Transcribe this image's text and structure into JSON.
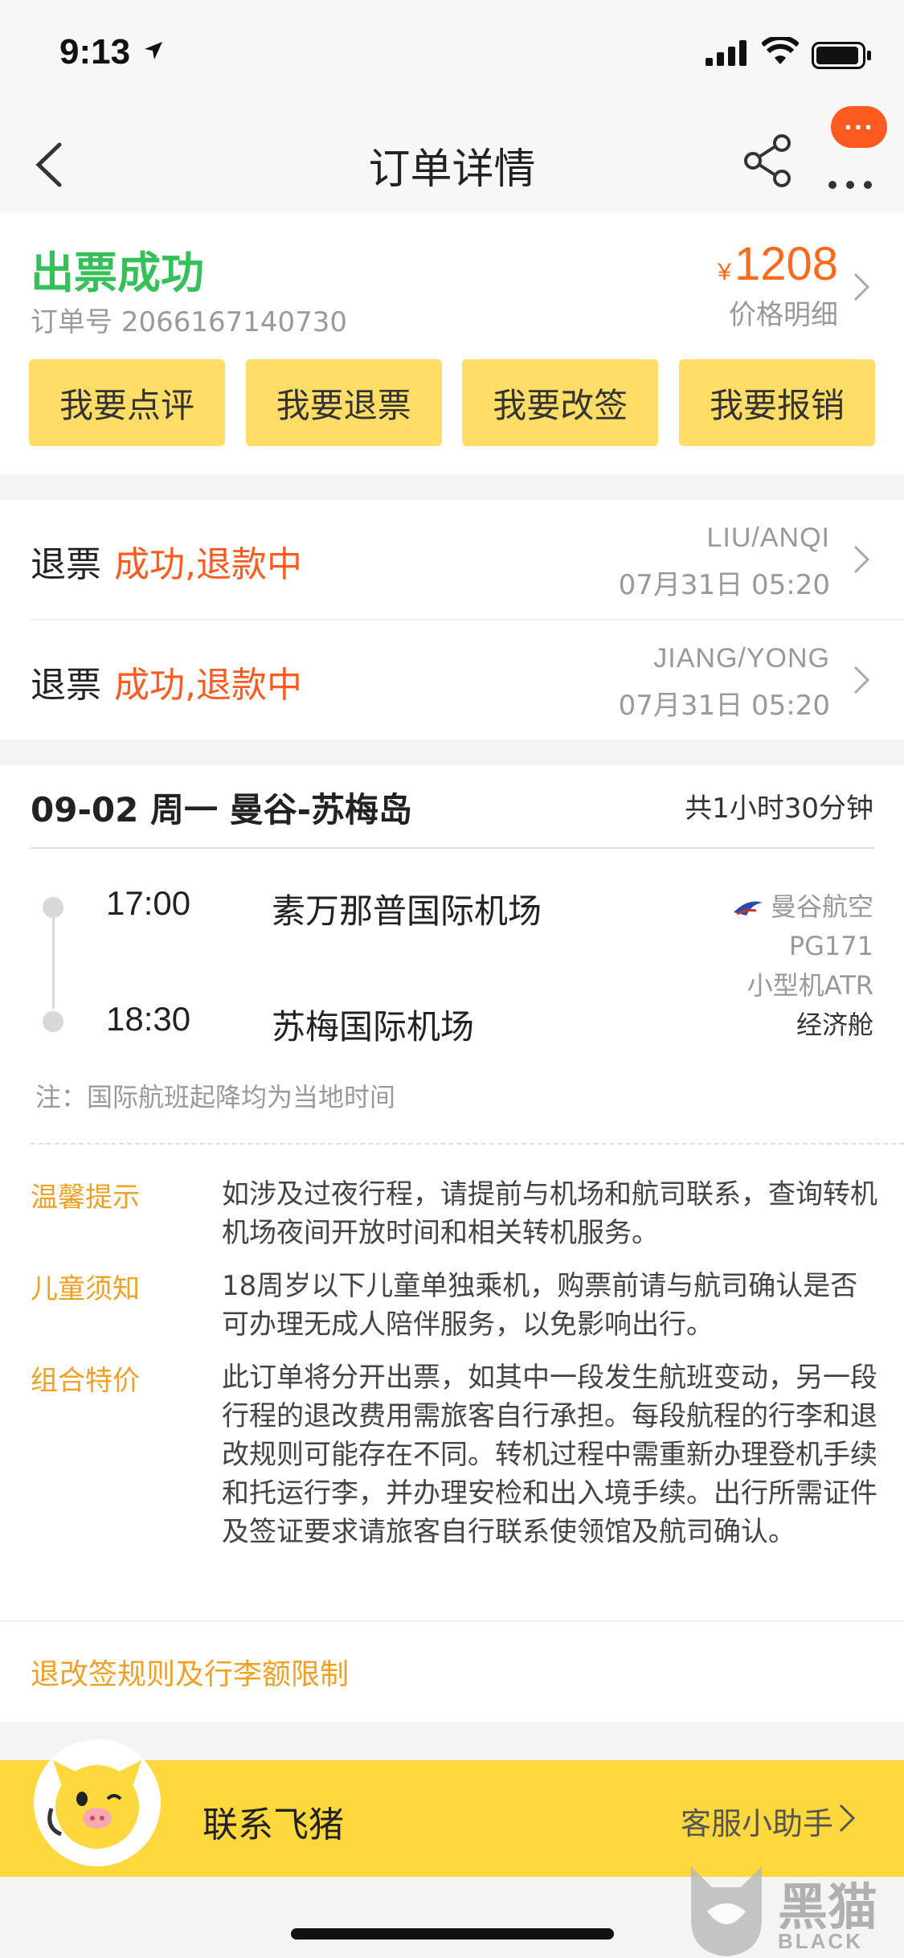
{
  "status_bar": {
    "time": "9:13"
  },
  "nav": {
    "title": "订单详情",
    "message_badge": "···"
  },
  "order": {
    "status": "出票成功",
    "order_no_label": "订单号",
    "order_no": "2066167140730",
    "currency": "¥",
    "price": "1208",
    "price_detail": "价格明细",
    "actions": [
      "我要点评",
      "我要退票",
      "我要改签",
      "我要报销"
    ]
  },
  "refunds": [
    {
      "label": "退票",
      "status": "成功,退款中",
      "name": "LIU/ANQI",
      "time": "07月31日 05:20"
    },
    {
      "label": "退票",
      "status": "成功,退款中",
      "name": "JIANG/YONG",
      "time": "07月31日 05:20"
    }
  ],
  "flight": {
    "date_route": "09-02 周一 曼谷-苏梅岛",
    "duration": "共1小时30分钟",
    "depart_time": "17:00",
    "depart_airport": "素万那普国际机场",
    "arrive_time": "18:30",
    "arrive_airport": "苏梅国际机场",
    "airline": "曼谷航空",
    "flight_no": "PG171",
    "aircraft": "小型机ATR",
    "cabin": "经济舱",
    "note": "注：国际航班起降均为当地时间"
  },
  "tips": [
    {
      "label": "温馨提示",
      "text": "如涉及过夜行程，请提前与机场和航司联系，查询转机机场夜间开放时间和相关转机服务。"
    },
    {
      "label": "儿童须知",
      "text": "18周岁以下儿童单独乘机，购票前请与航司确认是否可办理无成人陪伴服务，以免影响出行。"
    },
    {
      "label": "组合特价",
      "text": "此订单将分开出票，如其中一段发生航班变动，另一段行程的退改费用需旅客自行承担。每段航程的行李和退改规则可能存在不同。转机过程中需重新办理登机手续和托运行李，并办理安检和出入境手续。出行所需证件及签证要求请旅客自行联系使领馆及航司确认。"
    }
  ],
  "rules_link": "退改签规则及行李额限制",
  "contact": {
    "label": "联系飞猪",
    "assistant": "客服小助手"
  },
  "watermark": {
    "text": "黑猫",
    "sub": "BLACK CAT"
  },
  "colors": {
    "accent_orange": "#ff5a1f",
    "success_green": "#36c05a",
    "button_yellow": "#ffdd66",
    "tip_orange": "#f0a024",
    "footer_yellow": "#ffd83d"
  }
}
